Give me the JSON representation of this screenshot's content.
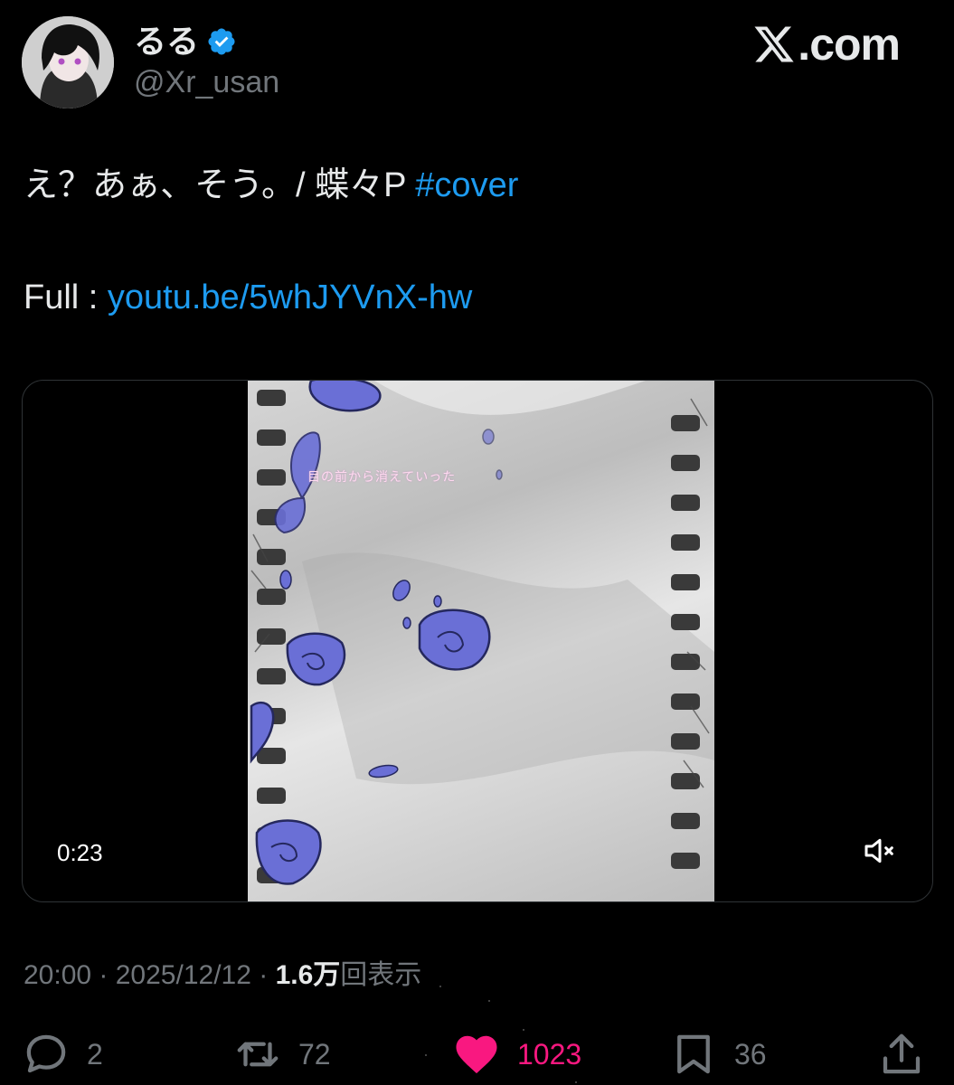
{
  "author": {
    "display_name": "るる",
    "handle": "@Xr_usan",
    "verified_icon": "verified-badge-icon"
  },
  "site": {
    "label": ".com"
  },
  "tweet": {
    "text_main": "え？あぁ、そう。/  蝶々P ",
    "hashtag": "#cover",
    "full_label": "Full : ",
    "link_text": "youtu.be/5whJYVnX-hw"
  },
  "media": {
    "lyric_caption": "目の前から消えていった",
    "time": "0:23",
    "mute_icon": "speaker-muted-icon"
  },
  "meta": {
    "time": "20:00",
    "separator": " · ",
    "date": "2025/12/12",
    "views_count": "1.6万",
    "views_label": "回表示"
  },
  "actions": {
    "reply_count": "2",
    "retweet_count": "72",
    "like_count": "1023",
    "bookmark_count": "36"
  },
  "colors": {
    "background": "#000000",
    "text": "#e7e9ea",
    "secondary": "#71767b",
    "link": "#1d9bf0",
    "like": "#f91880",
    "rose": "#6a6fd6"
  }
}
